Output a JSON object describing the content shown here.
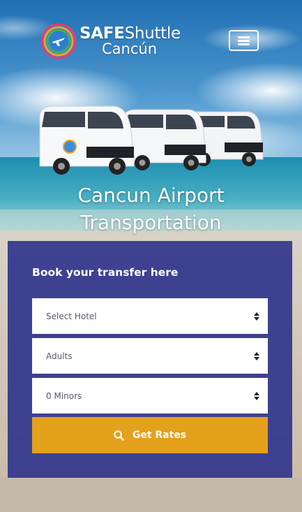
{
  "header": {
    "logo_word_bold": "SAFE",
    "logo_word_light": "Shuttle",
    "logo_word_2": "Cancún",
    "menu_icon": "hamburger-icon"
  },
  "hero": {
    "title_line_1": "Cancun Airport",
    "title_line_2": "Transportation"
  },
  "booking": {
    "title": "Book your transfer here",
    "hotel": {
      "value": "Select Hotel"
    },
    "adults": {
      "value": "Adults"
    },
    "minors": {
      "value": "0 Minors"
    },
    "submit_label": "Get Rates",
    "submit_icon": "search-icon"
  },
  "colors": {
    "panel": "#34388c",
    "button": "#e3a11c",
    "text_light": "#ffffff"
  }
}
